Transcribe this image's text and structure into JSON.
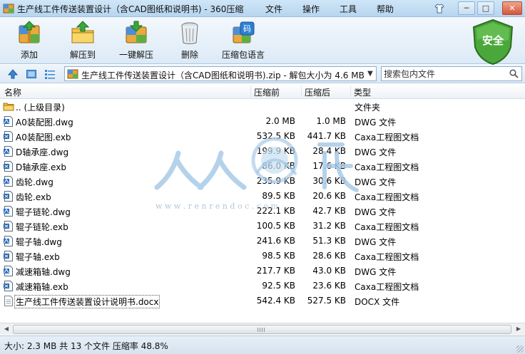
{
  "window": {
    "title": "生产线工件传送装置设计（含CAD图纸和说明书) - 360压缩",
    "menu": [
      "文件",
      "操作",
      "工具",
      "帮助"
    ],
    "controls": [
      "min",
      "max",
      "close"
    ]
  },
  "toolbar": {
    "add_label": "添加",
    "extract_label": "解压到",
    "oneclick_label": "一键解压",
    "delete_label": "删除",
    "language_label": "压缩包语言",
    "language_badge": "码",
    "security_label": "安全"
  },
  "address": {
    "path": "生产线工件传送装置设计（含CAD图纸和说明书).zip - 解包大小为 4.6 MB",
    "search_placeholder": "搜索包内文件"
  },
  "columns": {
    "name": "名称",
    "size": "压缩前",
    "packed": "压缩后",
    "type": "类型"
  },
  "files": [
    {
      "name": ".. (上级目录)",
      "size": "",
      "packed": "",
      "type": "文件夹",
      "icon": "folder-icon"
    },
    {
      "name": "A0装配图.dwg",
      "size": "2.0 MB",
      "packed": "1.0 MB",
      "type": "DWG 文件",
      "icon": "dwg-file-icon"
    },
    {
      "name": "A0装配图.exb",
      "size": "532.5 KB",
      "packed": "441.7 KB",
      "type": "Caxa工程图文档",
      "icon": "exb-file-icon"
    },
    {
      "name": "D轴承座.dwg",
      "size": "199.9 KB",
      "packed": "28.4 KB",
      "type": "DWG 文件",
      "icon": "dwg-file-icon"
    },
    {
      "name": "D轴承座.exb",
      "size": "86.0 KB",
      "packed": "17.6 KB",
      "type": "Caxa工程图文档",
      "icon": "exb-file-icon"
    },
    {
      "name": "齿轮.dwg",
      "size": "235.9 KB",
      "packed": "30.6 KB",
      "type": "DWG 文件",
      "icon": "dwg-file-icon"
    },
    {
      "name": "齿轮.exb",
      "size": "89.5 KB",
      "packed": "20.6 KB",
      "type": "Caxa工程图文档",
      "icon": "exb-file-icon"
    },
    {
      "name": "辊子链轮.dwg",
      "size": "222.1 KB",
      "packed": "42.7 KB",
      "type": "DWG 文件",
      "icon": "dwg-file-icon"
    },
    {
      "name": "辊子链轮.exb",
      "size": "100.5 KB",
      "packed": "31.2 KB",
      "type": "Caxa工程图文档",
      "icon": "exb-file-icon"
    },
    {
      "name": "辊子轴.dwg",
      "size": "241.6 KB",
      "packed": "51.3 KB",
      "type": "DWG 文件",
      "icon": "dwg-file-icon"
    },
    {
      "name": "辊子轴.exb",
      "size": "98.5 KB",
      "packed": "28.6 KB",
      "type": "Caxa工程图文档",
      "icon": "exb-file-icon"
    },
    {
      "name": "减速箱轴.dwg",
      "size": "217.7 KB",
      "packed": "43.0 KB",
      "type": "DWG 文件",
      "icon": "dwg-file-icon"
    },
    {
      "name": "减速箱轴.exb",
      "size": "92.5 KB",
      "packed": "23.6 KB",
      "type": "Caxa工程图文档",
      "icon": "exb-file-icon"
    },
    {
      "name": "生产线工件传送装置设计说明书.docx",
      "size": "542.4 KB",
      "packed": "527.5 KB",
      "type": "DOCX 文件",
      "icon": "docx-file-icon"
    }
  ],
  "watermark": {
    "url_text": "w w w . r e n r e n d o c . c o m"
  },
  "status": {
    "text": "大小: 2.3 MB 共 13 个文件 压缩率 48.8%"
  },
  "colors": {
    "title_bar": "#c4ddf3",
    "toolbar": "#e6f0f9",
    "shield_green": "#3d9a2e",
    "watermark_blue": "#9fc7e6"
  }
}
